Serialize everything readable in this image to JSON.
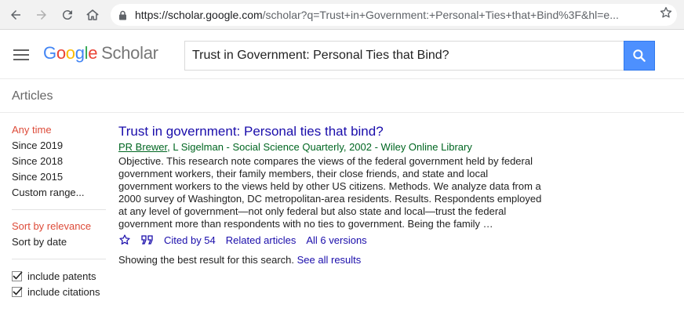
{
  "browser": {
    "url_host": "https://scholar.google.com",
    "url_rest": "/scholar?q=Trust+in+Government:+Personal+Ties+that+Bind%3F&hl=e..."
  },
  "header": {
    "logo_google": [
      "G",
      "o",
      "o",
      "g",
      "l",
      "e"
    ],
    "logo_scholar": "Scholar",
    "search_value": "Trust in Government: Personal Ties that Bind?"
  },
  "subheader": {
    "label": "Articles"
  },
  "sidebar": {
    "time_filters": [
      "Any time",
      "Since 2019",
      "Since 2018",
      "Since 2015",
      "Custom range..."
    ],
    "sort_options": [
      "Sort by relevance",
      "Sort by date"
    ],
    "checkboxes": [
      "include patents",
      "include citations"
    ]
  },
  "result": {
    "title": "Trust in government: Personal ties that bind?",
    "author_link": "PR Brewer",
    "meta_rest": ", L Sigelman - Social Science Quarterly, 2002 - Wiley Online Library",
    "snippet": "Objective. This research note compares the views of the federal government held by federal government workers, their family members, their close friends, and state and local government workers to the views held by other US citizens. Methods. We analyze data from a 2000 survey of Washington, DC metropolitan-area residents. Results. Respondents employed at any level of government—not only federal but also state and local—trust the federal government more than respondents with no ties to government. Being the family …",
    "cited_by": "Cited by 54",
    "related": "Related articles",
    "versions": "All 6 versions"
  },
  "footer": {
    "best_text": "Showing the best result for this search.",
    "see_all": "See all results"
  },
  "colors": {
    "link": "#1a0dab",
    "meta": "#006621",
    "selected": "#dd4b39",
    "search_button": "#4d90fe"
  }
}
